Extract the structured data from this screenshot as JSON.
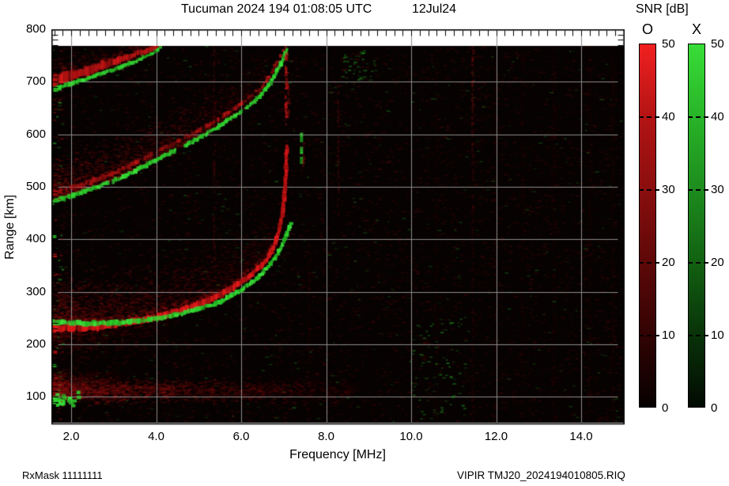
{
  "title": {
    "main": "Tucuman 2024 194 01:08:05 UTC",
    "date": "12Jul24"
  },
  "colorbar": {
    "title": "SNR [dB]",
    "o_header": "O",
    "x_header": "X",
    "tick_values": [
      50,
      40,
      30,
      20,
      10,
      0
    ],
    "tick_labels": [
      "50",
      "40",
      "30",
      "20",
      "10",
      "0"
    ],
    "dash_values": [
      40,
      30,
      20,
      10
    ],
    "o_gradient": [
      "#f12020",
      "#b31414",
      "#8a0e0e",
      "#5e0808",
      "#320303",
      "#070101"
    ],
    "x_gradient": [
      "#38dd38",
      "#28b428",
      "#1d8c1d",
      "#126112",
      "#093309",
      "#020a02"
    ]
  },
  "footer": {
    "left": "RxMask 11111111",
    "right": "VIPIR  TMJ20_2024194010805.RIQ"
  },
  "chart_data": {
    "type": "heatmap",
    "title": "Tucuman 2024 194 01:08:05 UTC   12Jul24",
    "xlabel": "Frequency [MHz]",
    "ylabel": "Range [km]",
    "xlim": [
      1.54,
      15.0
    ],
    "ylim": [
      46,
      800
    ],
    "x_ticks": [
      2,
      4,
      6,
      8,
      10,
      12,
      14
    ],
    "x_tick_labels": [
      "2.0",
      "4.0",
      "6.0",
      "8.0",
      "10.0",
      "12.0",
      "14.0"
    ],
    "y_ticks": [
      100,
      200,
      300,
      400,
      500,
      600,
      700,
      800
    ],
    "y_tick_labels": [
      "100",
      "200",
      "300",
      "400",
      "500",
      "600",
      "700",
      "800"
    ],
    "grid": true,
    "snr_scale_db": [
      0,
      50
    ],
    "background": "#070202",
    "palette": {
      "o_mode": "red",
      "x_mode": "green"
    },
    "traces": [
      {
        "name": "F 3-hop O-mode",
        "color_key": "red",
        "kind": "band",
        "w": [
          13,
          5
        ],
        "alpha": 0.6,
        "pts": [
          [
            1.54,
            701
          ],
          [
            2.0,
            712
          ],
          [
            2.5,
            724
          ],
          [
            3.0,
            738
          ],
          [
            3.5,
            752
          ],
          [
            3.9,
            763
          ],
          [
            4.08,
            770
          ]
        ]
      },
      {
        "name": "F 3-hop X-mode",
        "color_key": "green",
        "kind": "line",
        "w": [
          5,
          3.5
        ],
        "alpha": 0.8,
        "pts": [
          [
            1.6,
            686
          ],
          [
            2.1,
            699
          ],
          [
            2.6,
            712
          ],
          [
            3.1,
            726
          ],
          [
            3.6,
            742
          ],
          [
            3.95,
            756
          ],
          [
            4.12,
            766
          ]
        ]
      },
      {
        "name": "F 2-hop O-mode",
        "color_key": "red",
        "kind": "dashedline",
        "w": [
          6,
          4
        ],
        "alpha": 0.5,
        "pts": [
          [
            1.54,
            486
          ],
          [
            2.0,
            497
          ],
          [
            2.5,
            511
          ],
          [
            3.0,
            526
          ],
          [
            3.5,
            545
          ],
          [
            4.0,
            566
          ],
          [
            4.5,
            586
          ],
          [
            5.0,
            607
          ],
          [
            5.5,
            631
          ],
          [
            6.0,
            658
          ],
          [
            6.45,
            687
          ],
          [
            6.7,
            715
          ],
          [
            6.9,
            744
          ],
          [
            7.0,
            762
          ]
        ]
      },
      {
        "name": "F 2-hop X-mode",
        "color_key": "green",
        "kind": "line",
        "w": [
          5.5,
          4
        ],
        "alpha": 0.85,
        "gaps": [
          [
            2.88,
            2.97
          ],
          [
            4.5,
            4.67
          ],
          [
            6.02,
            6.1
          ]
        ],
        "pts": [
          [
            1.54,
            471
          ],
          [
            2.0,
            482
          ],
          [
            2.5,
            496
          ],
          [
            3.0,
            511
          ],
          [
            3.5,
            530
          ],
          [
            4.0,
            551
          ],
          [
            4.5,
            571
          ],
          [
            5.0,
            592
          ],
          [
            5.5,
            616
          ],
          [
            6.0,
            643
          ],
          [
            6.45,
            672
          ],
          [
            6.7,
            700
          ],
          [
            6.9,
            729
          ],
          [
            7.0,
            746
          ],
          [
            7.08,
            766
          ]
        ]
      },
      {
        "name": "F 2-hop O asymptote",
        "color_key": "red",
        "kind": "streak",
        "x_mhz": 7.06,
        "r_range": [
          618,
          768
        ],
        "alpha": 0.7,
        "sw": 3.5
      },
      {
        "name": "F 2-hop O asymptote wisp",
        "color_key": "red",
        "kind": "streak",
        "x_mhz": 7.12,
        "r_range": [
          630,
          700
        ],
        "alpha": 0.28,
        "sw": 3
      },
      {
        "name": "F 1-hop O-mode",
        "color_key": "red",
        "kind": "band",
        "w": [
          9,
          4.5
        ],
        "alpha": 0.92,
        "pts": [
          [
            1.54,
            230
          ],
          [
            2.0,
            231
          ],
          [
            2.5,
            233
          ],
          [
            3.0,
            237
          ],
          [
            3.5,
            243
          ],
          [
            4.0,
            251
          ],
          [
            4.5,
            262
          ],
          [
            5.0,
            276
          ],
          [
            5.5,
            294
          ],
          [
            6.0,
            318
          ],
          [
            6.3,
            336
          ],
          [
            6.6,
            360
          ],
          [
            6.8,
            390
          ],
          [
            6.93,
            430
          ],
          [
            7.0,
            470
          ],
          [
            7.04,
            510
          ],
          [
            7.06,
            545
          ],
          [
            7.07,
            578
          ]
        ]
      },
      {
        "name": "F 1-hop X-mode",
        "color_key": "green",
        "kind": "line",
        "w": [
          6,
          4
        ],
        "alpha": 0.9,
        "pts": [
          [
            1.54,
            242
          ],
          [
            2.2,
            240
          ],
          [
            3.0,
            240
          ],
          [
            3.8,
            246
          ],
          [
            4.6,
            258
          ],
          [
            5.4,
            277
          ],
          [
            6.0,
            303
          ],
          [
            6.4,
            327
          ],
          [
            6.7,
            354
          ],
          [
            6.9,
            378
          ],
          [
            7.05,
            405
          ],
          [
            7.12,
            420
          ],
          [
            7.17,
            432
          ]
        ]
      },
      {
        "name": "F 1-hop X asymptote dashes",
        "color_key": "green",
        "kind": "dashes",
        "x_mhz": 7.42,
        "segs": [
          [
            545,
            557
          ],
          [
            566,
            576
          ],
          [
            588,
            603
          ]
        ],
        "alpha": 0.85,
        "sw": 4
      },
      {
        "name": "F 1-hop X asymptote wisp",
        "color_key": "red",
        "kind": "streak",
        "x_mhz": 7.47,
        "r_range": [
          543,
          585
        ],
        "alpha": 0.32,
        "sw": 2.5
      }
    ],
    "rfi_streaks": [
      {
        "f": 5.37,
        "r": [
          358,
          768
        ],
        "alpha": 0.26,
        "w": 2.5
      },
      {
        "f": 8.29,
        "r": [
          446,
          693
        ],
        "alpha": 0.3,
        "w": 2.5
      },
      {
        "f": 7.6,
        "r": [
          57,
          434
        ],
        "alpha": 0.1,
        "w": 3
      },
      {
        "f": 11.45,
        "r": [
          403,
          768
        ],
        "alpha": 0.5,
        "w": 3,
        "fade": "down"
      },
      {
        "f": 11.45,
        "r": [
          56,
          403
        ],
        "alpha": 0.12,
        "w": 3
      },
      {
        "f": 12.0,
        "r": [
          50,
          768
        ],
        "alpha": 0.11,
        "w": 3
      },
      {
        "f": 10.6,
        "r": [
          50,
          768
        ],
        "alpha": 0.06,
        "w": 4
      },
      {
        "f": 12.62,
        "r": [
          50,
          768
        ],
        "alpha": 0.07,
        "w": 4
      },
      {
        "f": 13.36,
        "r": [
          50,
          768
        ],
        "alpha": 0.07,
        "w": 4
      },
      {
        "f": 14.2,
        "r": [
          50,
          768
        ],
        "alpha": 0.08,
        "w": 4
      },
      {
        "f": 14.75,
        "r": [
          50,
          768
        ],
        "alpha": 0.09,
        "w": 4
      }
    ],
    "noise": {
      "background_red": {
        "count": 5200,
        "alpha": [
          0.05,
          0.26
        ]
      },
      "background_green": {
        "count": 430,
        "alpha": [
          0.1,
          0.38
        ]
      },
      "clouds": [
        {
          "base": 1,
          "f": [
            1.54,
            4.2
          ],
          "above_km": [
            4,
            70
          ],
          "count": 700,
          "alpha": [
            0.07,
            0.3
          ],
          "bias": 1.2
        },
        {
          "base": 3,
          "f": [
            1.54,
            6.55
          ],
          "above_km": [
            4,
            90
          ],
          "count": 2400,
          "alpha": [
            0.08,
            0.45
          ],
          "bias": 1.25
        },
        {
          "base": 6,
          "f": [
            1.54,
            6.7
          ],
          "above_km": [
            6,
            115
          ],
          "count": 2600,
          "alpha": [
            0.08,
            0.42
          ],
          "bias": 1.3
        },
        {
          "base": 6,
          "f": [
            1.54,
            4.3
          ],
          "above_km": [
            -75,
            -8
          ],
          "count": 650,
          "alpha": [
            0.06,
            0.28
          ],
          "bias": 1.4
        }
      ],
      "e_band": [
        {
          "f": [
            1.54,
            8.6
          ],
          "r_center": 112,
          "r_sigma": 10,
          "count": 2300,
          "alpha": [
            0.1,
            0.5
          ],
          "bias": 1.8
        },
        {
          "f": [
            1.54,
            3.2
          ],
          "r_center": 136,
          "r_sigma": 8,
          "count": 330,
          "alpha": [
            0.07,
            0.28
          ],
          "bias": 1.3
        }
      ],
      "e_band_green_blobs": {
        "f": [
          1.54,
          2.15
        ],
        "r": [
          85,
          112
        ],
        "count": 26
      },
      "green_clusters": [
        {
          "f": [
            8.35,
            9.15
          ],
          "r": [
            700,
            762
          ],
          "count": 45,
          "alpha": [
            0.15,
            0.5
          ]
        },
        {
          "f": [
            9.95,
            11.3
          ],
          "r": [
            55,
            250
          ],
          "count": 85,
          "alpha": [
            0.15,
            0.55
          ]
        }
      ],
      "left_edge_blobs": {
        "f": [
          1.54,
          1.78
        ],
        "r": [
          55,
          765
        ],
        "count": 90
      },
      "left_edge_marks": [
        {
          "f": 1.56,
          "r": 408,
          "color": "green"
        },
        {
          "f": 1.57,
          "r": 372,
          "color": "red"
        },
        {
          "f": 1.58,
          "r": 188,
          "color": "red"
        },
        {
          "f": 1.56,
          "r": 162,
          "color": "green"
        },
        {
          "f": 1.6,
          "r": 140,
          "color": "red"
        }
      ]
    }
  }
}
